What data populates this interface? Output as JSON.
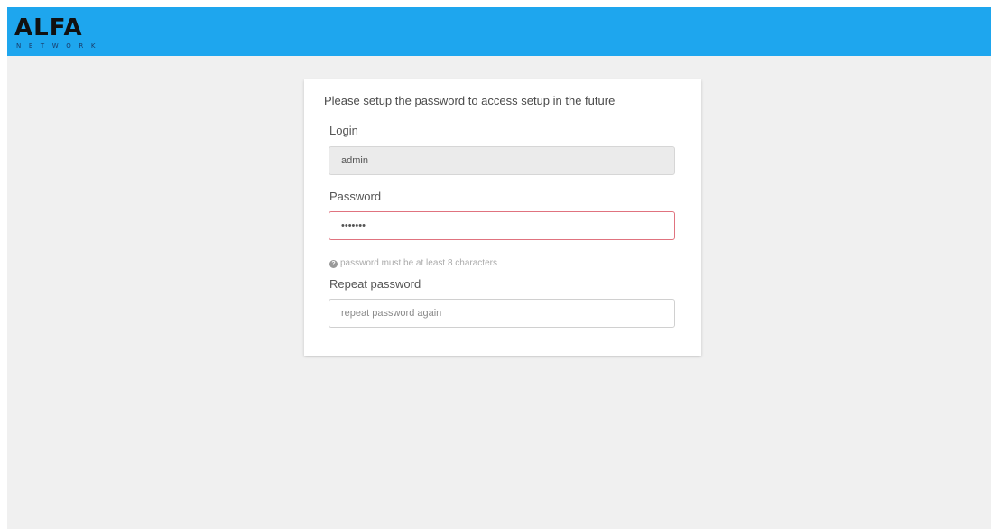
{
  "header": {
    "logo_text": "ALFA",
    "logo_subtext": "NETWORK",
    "color": "#1ea6ee"
  },
  "setup_card": {
    "heading": "Please setup the password to access setup in the future",
    "login": {
      "label": "Login",
      "value": "admin"
    },
    "password": {
      "label": "Password",
      "value": "•••••••",
      "border_color": "#e0737f"
    },
    "hint": {
      "icon": "question-circle-icon",
      "text": "password must be at least 8 characters"
    },
    "repeat_password": {
      "label": "Repeat password",
      "placeholder": "repeat password again",
      "value": ""
    }
  }
}
